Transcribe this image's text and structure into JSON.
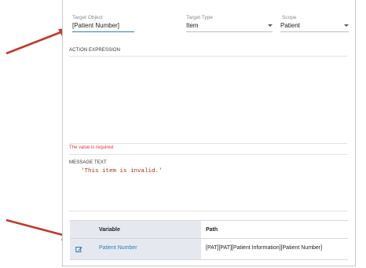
{
  "form": {
    "target_object": {
      "label": "Target Object",
      "value": "[Patient Number]"
    },
    "target_type": {
      "label": "Target Type",
      "value": "Item"
    },
    "scope": {
      "label": "Scope",
      "value": "Patient"
    },
    "action_expression": {
      "label": "ACTION EXPRESSION",
      "value": "",
      "error": "The value is required"
    },
    "message_text": {
      "label": "MESSAGE TEXT",
      "value": "'This item is invalid.'"
    }
  },
  "variables_table": {
    "headers": {
      "variable": "Variable",
      "path": "Path"
    },
    "rows": [
      {
        "variable": "Patient Number",
        "path": "[PAT][PAT][Patient Information][Patient Number]"
      }
    ]
  },
  "colors": {
    "link": "#2c7fb8",
    "error": "#e53935",
    "code": "#b5281f",
    "annotation_arrow": "#c0392b",
    "table_left_bg": "#e6e8f0"
  },
  "icons": {
    "edit": "edit-icon",
    "dropdown": "chevron-down-icon",
    "annotation": "red-arrow-annotation"
  }
}
